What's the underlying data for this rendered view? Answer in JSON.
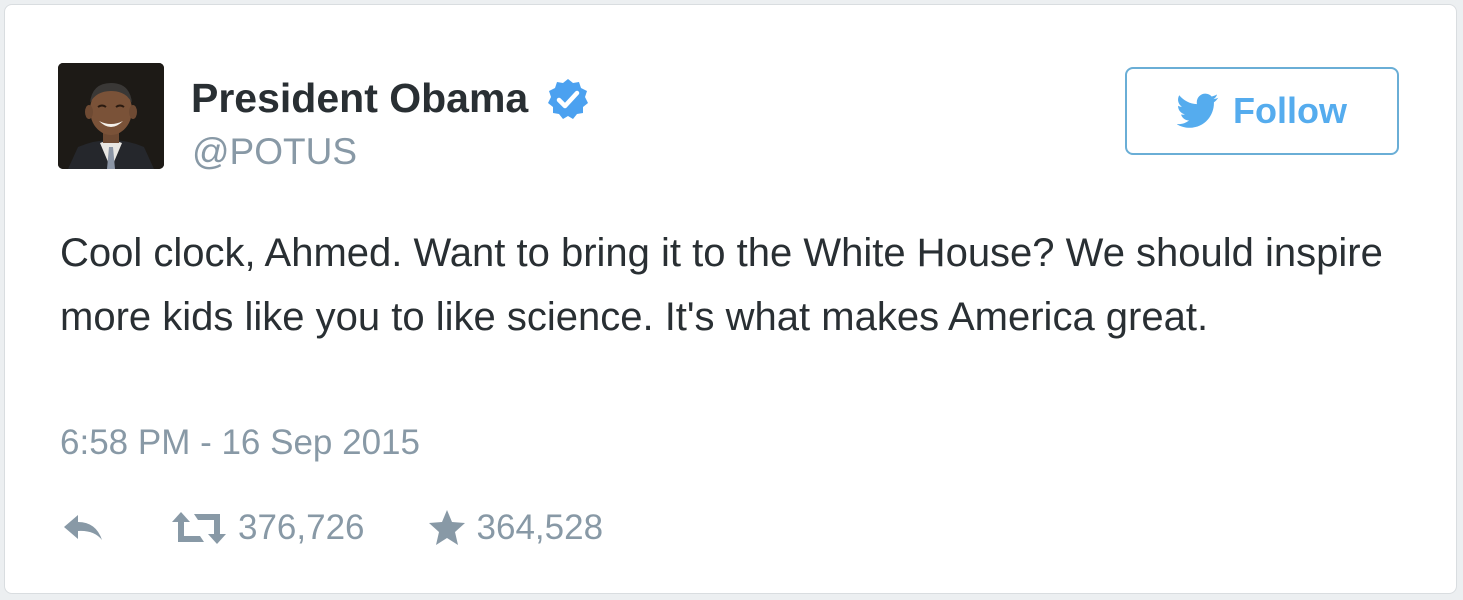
{
  "author": {
    "name": "President Obama",
    "handle": "@POTUS",
    "verified": true
  },
  "follow_button": {
    "label": "Follow",
    "icon": "twitter-bird-icon"
  },
  "tweet": {
    "text": "Cool clock, Ahmed. Want to bring it to the White House? We should inspire more kids like you to like science. It's what makes America great.",
    "timestamp": "6:58 PM - 16 Sep 2015"
  },
  "actions": {
    "reply_icon": "reply-icon",
    "retweet_icon": "retweet-icon",
    "retweet_count": "376,726",
    "favorite_icon": "star-icon",
    "favorite_count": "364,528"
  },
  "colors": {
    "name_text": "#292f33",
    "muted_text": "#8899a6",
    "accent": "#55acee",
    "verified_badge": "#4ba1f0"
  }
}
